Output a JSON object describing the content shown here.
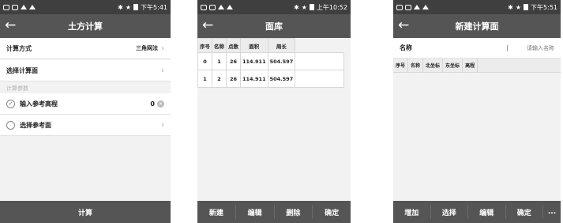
{
  "screen1": {
    "status_time": "下午5:41",
    "title": "土方计算",
    "calc_method": {
      "label": "计算方式",
      "value": "三角网法"
    },
    "select_surface": {
      "label": "选择计算面"
    },
    "section_params": "计算参数",
    "ref_elevation": {
      "label": "输入参考高程",
      "value": "0"
    },
    "ref_surface": {
      "label": "选择参考面"
    },
    "calc_button": "计算"
  },
  "screen2": {
    "status_time": "上午10:52",
    "title": "面库",
    "columns": [
      "序号",
      "名称",
      "点数",
      "面积",
      "周长"
    ],
    "rows": [
      [
        "0",
        "1",
        "26",
        "114.911",
        "504.597"
      ],
      [
        "1",
        "2",
        "26",
        "114.911",
        "504.597"
      ]
    ],
    "buttons": {
      "new": "新建",
      "edit": "编辑",
      "delete": "删除",
      "ok": "确定"
    }
  },
  "screen3": {
    "status_time": "下午5:51",
    "title": "新建计算面",
    "name_label": "名称",
    "name_placeholder": "请输入名称",
    "columns": [
      "序号",
      "名称",
      "北坐标",
      "东坐标",
      "高程"
    ],
    "buttons": {
      "add": "增加",
      "select": "选择",
      "edit": "编辑",
      "ok": "确定",
      "more": "..."
    }
  }
}
